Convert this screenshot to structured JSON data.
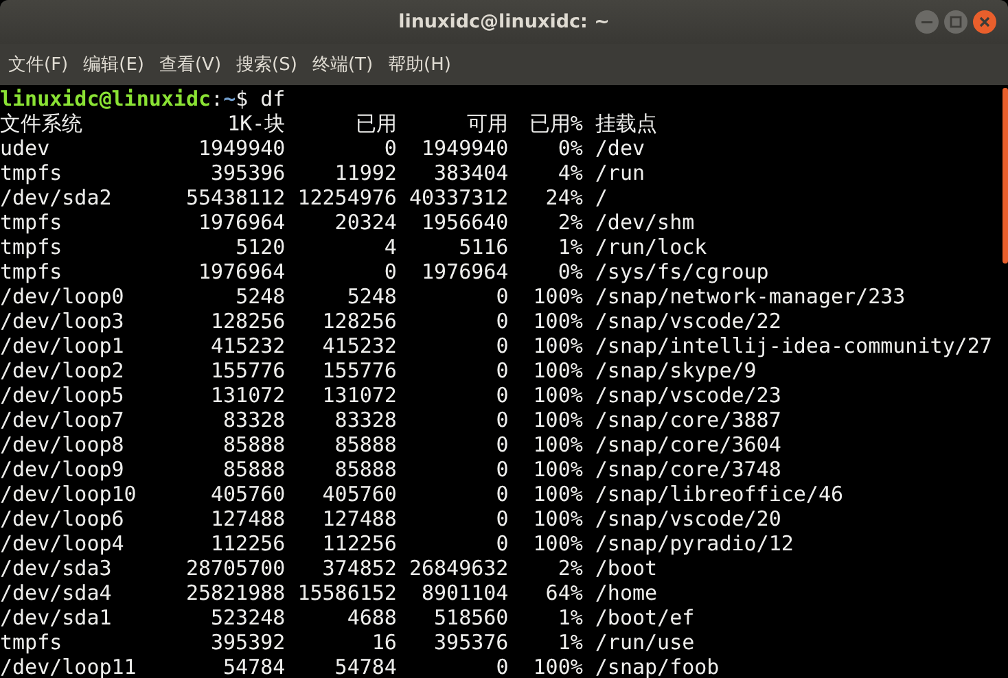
{
  "window": {
    "title": "linuxidc@linuxidc: ~"
  },
  "menu": [
    "文件(F)",
    "编辑(E)",
    "查看(V)",
    "搜索(S)",
    "终端(T)",
    "帮助(H)"
  ],
  "prompt": {
    "user_host": "linuxidc@linuxidc",
    "separator": ":",
    "path": "~",
    "symbol": "$",
    "command": "df"
  },
  "table": {
    "columns": [
      "文件系统",
      "1K-块",
      "已用",
      "可用",
      "已用%",
      "挂载点"
    ],
    "rows": [
      [
        "udev",
        "1949940",
        "0",
        "1949940",
        "0%",
        "/dev"
      ],
      [
        "tmpfs",
        "395396",
        "11992",
        "383404",
        "4%",
        "/run"
      ],
      [
        "/dev/sda2",
        "55438112",
        "12254976",
        "40337312",
        "24%",
        "/"
      ],
      [
        "tmpfs",
        "1976964",
        "20324",
        "1956640",
        "2%",
        "/dev/shm"
      ],
      [
        "tmpfs",
        "5120",
        "4",
        "5116",
        "1%",
        "/run/lock"
      ],
      [
        "tmpfs",
        "1976964",
        "0",
        "1976964",
        "0%",
        "/sys/fs/cgroup"
      ],
      [
        "/dev/loop0",
        "5248",
        "5248",
        "0",
        "100%",
        "/snap/network-manager/233"
      ],
      [
        "/dev/loop3",
        "128256",
        "128256",
        "0",
        "100%",
        "/snap/vscode/22"
      ],
      [
        "/dev/loop1",
        "415232",
        "415232",
        "0",
        "100%",
        "/snap/intellij-idea-community/27"
      ],
      [
        "/dev/loop2",
        "155776",
        "155776",
        "0",
        "100%",
        "/snap/skype/9"
      ],
      [
        "/dev/loop5",
        "131072",
        "131072",
        "0",
        "100%",
        "/snap/vscode/23"
      ],
      [
        "/dev/loop7",
        "83328",
        "83328",
        "0",
        "100%",
        "/snap/core/3887"
      ],
      [
        "/dev/loop8",
        "85888",
        "85888",
        "0",
        "100%",
        "/snap/core/3604"
      ],
      [
        "/dev/loop9",
        "85888",
        "85888",
        "0",
        "100%",
        "/snap/core/3748"
      ],
      [
        "/dev/loop10",
        "405760",
        "405760",
        "0",
        "100%",
        "/snap/libreoffice/46"
      ],
      [
        "/dev/loop6",
        "127488",
        "127488",
        "0",
        "100%",
        "/snap/vscode/20"
      ],
      [
        "/dev/loop4",
        "112256",
        "112256",
        "0",
        "100%",
        "/snap/pyradio/12"
      ],
      [
        "/dev/sda3",
        "28705700",
        "374852",
        "26849632",
        "2%",
        "/boot"
      ],
      [
        "/dev/sda4",
        "25821988",
        "15586152",
        "8901104",
        "64%",
        "/home"
      ],
      [
        "/dev/sda1",
        "523248",
        "4688",
        "518560",
        "1%",
        "/boot/ef"
      ],
      [
        "tmpfs",
        "395392",
        "16",
        "395376",
        "1%",
        "/run/use"
      ],
      [
        "/dev/loop11",
        "54784",
        "54784",
        "0",
        "100%",
        "/snap/foob"
      ]
    ]
  }
}
